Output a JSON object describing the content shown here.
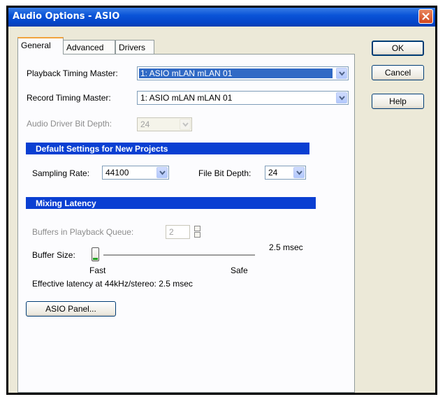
{
  "window": {
    "title": "Audio Options - ASIO"
  },
  "tabs": [
    {
      "label": "General",
      "active": true
    },
    {
      "label": "Advanced",
      "active": false
    },
    {
      "label": "Drivers",
      "active": false
    }
  ],
  "buttons": {
    "ok": "OK",
    "cancel": "Cancel",
    "help": "Help",
    "asio_panel": "ASIO Panel..."
  },
  "general": {
    "playback_timing_master": {
      "label": "Playback Timing Master:",
      "value": "1: ASIO mLAN mLAN 01"
    },
    "record_timing_master": {
      "label": "Record Timing Master:",
      "value": "1: ASIO mLAN mLAN 01"
    },
    "audio_driver_bit_depth": {
      "label": "Audio Driver Bit Depth:",
      "value": "24",
      "enabled": false
    }
  },
  "default_settings": {
    "header": "Default Settings for New Projects",
    "sampling_rate": {
      "label": "Sampling Rate:",
      "value": "44100"
    },
    "file_bit_depth": {
      "label": "File Bit Depth:",
      "value": "24"
    }
  },
  "mixing_latency": {
    "header": "Mixing Latency",
    "buffers_in_playback_queue": {
      "label": "Buffers in Playback Queue:",
      "value": "2",
      "enabled": false
    },
    "buffer_size": {
      "label": "Buffer Size:",
      "value_text": "2.5 msec",
      "slider_position": 0.0
    },
    "slider_min_label": "Fast",
    "slider_max_label": "Safe",
    "effective_latency": "Effective latency at 44kHz/stereo:  2.5 msec"
  },
  "colors": {
    "titlebar": "#0a54d8",
    "section_header": "#0a3fd2",
    "selection": "#316ac5",
    "close_button": "#d2461c"
  },
  "icons": {
    "close": "close-x-icon",
    "dropdown": "chevron-down-icon",
    "spin": "spin-arrows-icon"
  }
}
